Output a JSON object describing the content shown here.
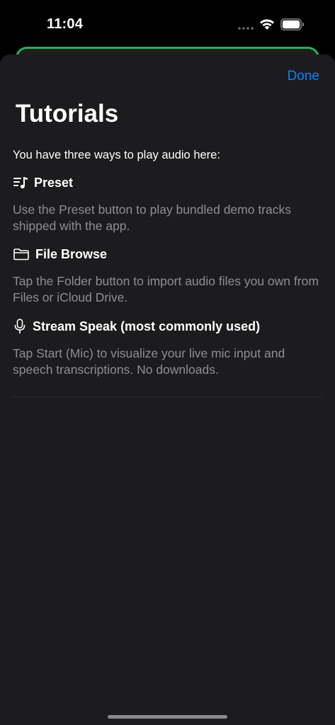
{
  "status_bar": {
    "time": "11:04"
  },
  "header": {
    "done_label": "Done",
    "title": "Tutorials"
  },
  "intro": "You have three ways to play audio here:",
  "sections": [
    {
      "icon": "music-list-icon",
      "title": "Preset",
      "body": "Use the Preset button to play bundled demo tracks shipped with the app."
    },
    {
      "icon": "folder-icon",
      "title": "File Browse",
      "body": "Tap the Folder button to import audio files you own from Files or iCloud Drive."
    },
    {
      "icon": "microphone-icon",
      "title": "Stream Speak (most commonly used)",
      "body": "Tap Start (Mic) to visualize your live mic input and speech transcriptions. No downloads."
    }
  ],
  "colors": {
    "accent": "#0a84ff",
    "sheet_background": "#1c1c1e",
    "secondary_text": "#8e8e93",
    "back_card_border": "#2fae52"
  }
}
